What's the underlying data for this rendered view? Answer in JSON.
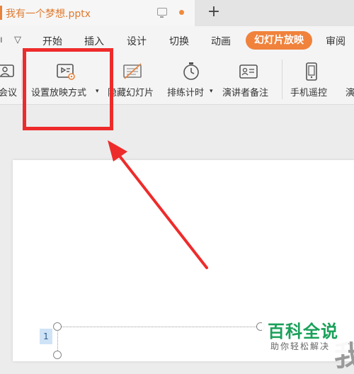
{
  "tab": {
    "title": "我有一个梦想.pptx",
    "new_tab_symbol": "+",
    "icons": [
      "monitor-icon",
      "unsaved-dot"
    ]
  },
  "menu": {
    "items": [
      "开始",
      "插入",
      "设计",
      "切换",
      "动画"
    ],
    "active": "幻灯片放映",
    "trailing": "审阅",
    "left_symbols": [
      "ı",
      "▽"
    ]
  },
  "toolbar": {
    "items": [
      {
        "label": "会议",
        "icon": "meeting-icon"
      },
      {
        "label": "设置放映方式",
        "suffix": "▾",
        "icon": "slideshow-settings-icon"
      },
      {
        "label": "隐藏幻灯片",
        "icon": "hide-slide-icon"
      },
      {
        "label": "排练计时",
        "suffix": "▾",
        "icon": "stopwatch-icon"
      },
      {
        "label": "演讲者备注",
        "icon": "speaker-notes-icon"
      },
      {
        "label": "手机遥控",
        "icon": "phone-icon"
      },
      {
        "label": "演",
        "icon": ""
      }
    ]
  },
  "slide": {
    "number": "1",
    "partial_text": "我"
  },
  "watermark": {
    "title": "百科全说",
    "subtitle": "助你轻松解决"
  },
  "colors": {
    "accent": "#f0823c",
    "annotation": "#ee2b2b",
    "watermark_green": "#1aa05a"
  }
}
